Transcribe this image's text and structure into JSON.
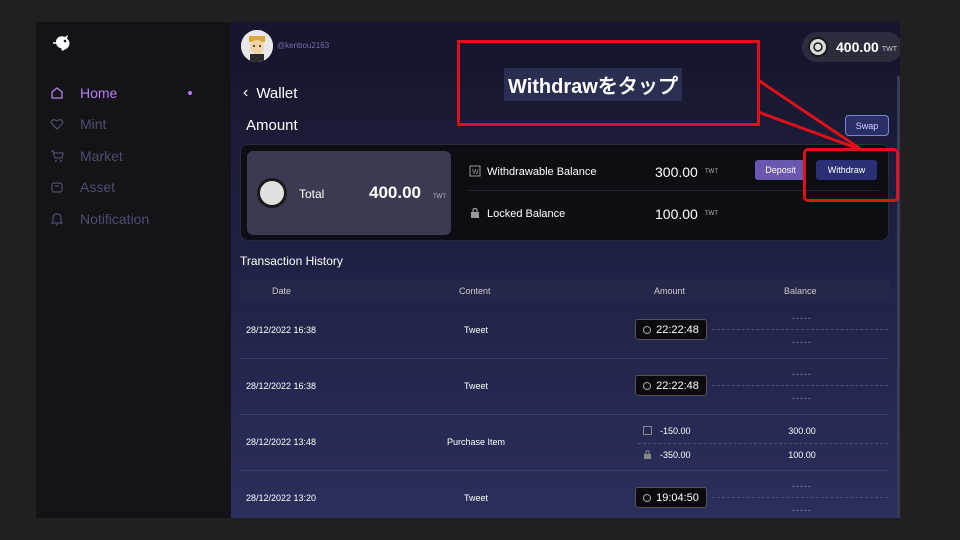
{
  "sidebar": {
    "items": [
      {
        "label": "Home",
        "icon": "home-icon",
        "active": true
      },
      {
        "label": "Mint",
        "icon": "heart-icon"
      },
      {
        "label": "Market",
        "icon": "cart-icon"
      },
      {
        "label": "Asset",
        "icon": "box-icon"
      },
      {
        "label": "Notification",
        "icon": "bell-icon"
      }
    ]
  },
  "header": {
    "username": "@kenbou2163",
    "balance": "400.00",
    "balance_unit": "TWT"
  },
  "page": {
    "back_title": "Wallet",
    "amount_title": "Amount",
    "swap_label": "Swap"
  },
  "amount_card": {
    "total_label": "Total",
    "total_amount": "400.00",
    "total_unit": "TWT",
    "withdrawable_label": "Withdrawable Balance",
    "withdrawable_amount": "300.00",
    "withdrawable_unit": "TWT",
    "locked_label": "Locked Balance",
    "locked_amount": "100.00",
    "locked_unit": "TWT",
    "deposit_label": "Deposit",
    "withdraw_label": "Withdraw"
  },
  "transactions": {
    "title": "Transaction History",
    "columns": [
      "Date",
      "Content",
      "Amount",
      "Balance"
    ],
    "rows": [
      {
        "date": "28/12/2022 16:38",
        "content": "Tweet",
        "amount": "22:22:48",
        "balance_top": "-----",
        "balance_bottom": "-----"
      },
      {
        "date": "28/12/2022 16:38",
        "content": "Tweet",
        "amount": "22:22:48",
        "balance_top": "-----",
        "balance_bottom": "-----"
      },
      {
        "date": "28/12/2022 13:48",
        "content": "Purchase Item",
        "amount_top": "-150.00",
        "amount_bottom": "-350.00",
        "balance_top": "300.00",
        "balance_bottom": "100.00"
      },
      {
        "date": "28/12/2022 13:20",
        "content": "Tweet",
        "amount": "19:04:50",
        "balance_top": "-----",
        "balance_bottom": "-----"
      }
    ]
  },
  "annotation": {
    "callout_text": "Withdrawをタップ",
    "color": "#e0101a"
  },
  "colors": {
    "accent": "#b67ef0",
    "deposit": "#6a58b0",
    "withdraw": "#2b2f75"
  }
}
